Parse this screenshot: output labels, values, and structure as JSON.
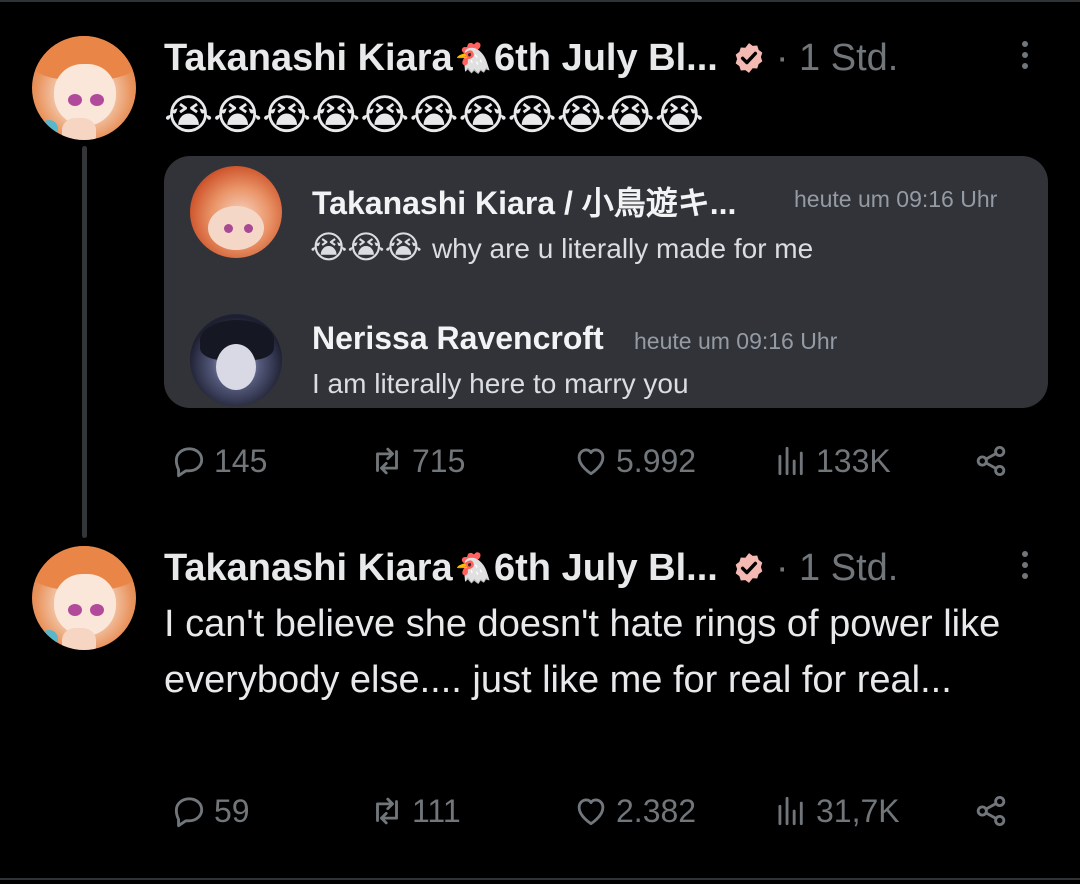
{
  "colors": {
    "background": "#000000",
    "text": "#e7e9ea",
    "muted": "#71767b",
    "card": "#313338",
    "verified": "#f4b9b2"
  },
  "tweet1": {
    "display_name": "Takanashi Kiara",
    "name_emoji": "🐔",
    "name_suffix": "6th July Bl...",
    "time": "· 1 Std.",
    "emoji_line": "😭😭😭😭😭😭😭😭😭😭😭",
    "embed": {
      "message1": {
        "author": "Takanashi Kiara / 小鳥遊キ...",
        "timestamp": "heute um 09:16 Uhr",
        "emojis": "😭😭😭",
        "text": "why are u literally made for me"
      },
      "message2": {
        "author": "Nerissa Ravencroft",
        "timestamp": "heute um 09:16 Uhr",
        "text": "I am literally here to marry you"
      }
    },
    "stats": {
      "replies": "145",
      "reposts": "715",
      "likes": "5.992",
      "views": "133K"
    }
  },
  "tweet2": {
    "display_name": "Takanashi Kiara",
    "name_emoji": "🐔",
    "name_suffix": "6th July Bl...",
    "time": "· 1 Std.",
    "text": "I can't believe she doesn't hate  rings of power like everybody else.... just like me for real for real...",
    "stats": {
      "replies": "59",
      "reposts": "111",
      "likes": "2.382",
      "views": "31,7K"
    }
  },
  "icons": {
    "reply": "reply-bubble-icon",
    "repost": "repost-arrows-icon",
    "like": "heart-icon",
    "views": "bar-chart-icon",
    "share": "share-nodes-icon",
    "more": "more-vertical-icon",
    "verified": "verified-badge-icon"
  }
}
